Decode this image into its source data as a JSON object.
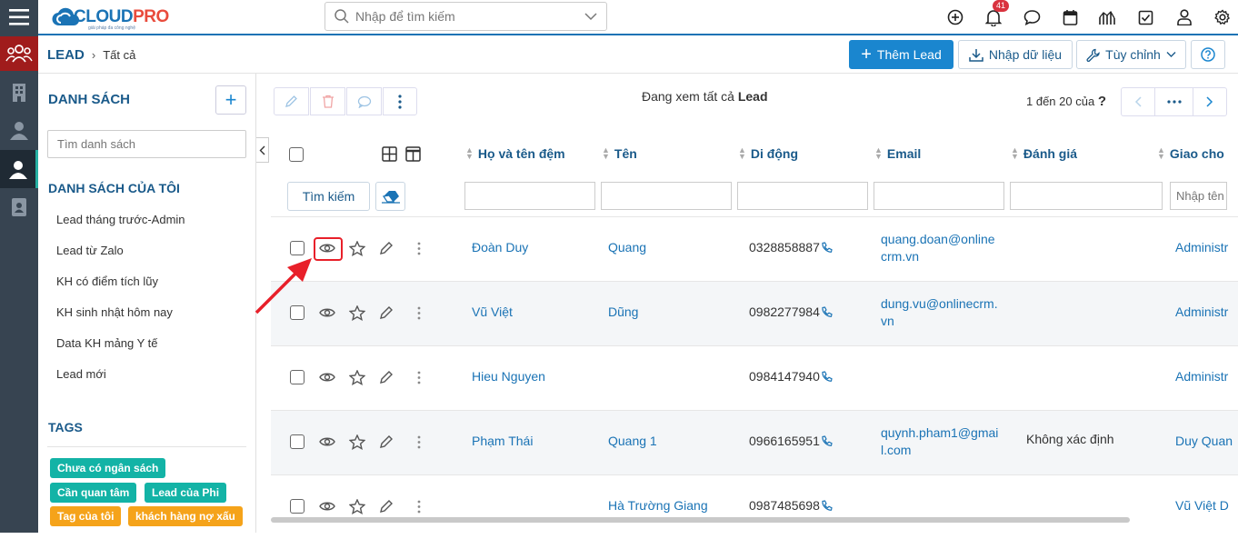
{
  "topbar": {
    "logo_text_a": "CLOUD",
    "logo_text_b": "PRO",
    "logo_sub": "giải pháp đa công nghệ",
    "search_placeholder": "Nhập để tìm kiếm",
    "notification_count": "41"
  },
  "breadcrumb": {
    "module": "LEAD",
    "separator": "›",
    "current": "Tất cả"
  },
  "actions": {
    "add_label": "Thêm Lead",
    "import_label": "Nhập dữ liệu",
    "customize_label": "Tùy chỉnh"
  },
  "sidebar": {
    "list_heading": "DANH SÁCH",
    "list_search_placeholder": "Tìm danh sách",
    "my_lists_heading": "DANH SÁCH CỦA TÔI",
    "my_lists": [
      "Lead tháng trước-Admin",
      "Lead từ Zalo",
      "KH có điểm tích lũy",
      "KH sinh nhật hôm nay",
      "Data KH mảng Y tế",
      "Lead mới"
    ],
    "tags_heading": "TAGS",
    "tags": [
      "Chưa có ngân sách",
      "Cần quan tâm",
      "Lead của Phi",
      "Tag của tôi",
      "khách hàng nợ xấu"
    ]
  },
  "list": {
    "viewing_prefix": "Đang xem tất cả",
    "viewing_module": "Lead",
    "pager_text": "1 đến 20 của",
    "pager_more": "?",
    "search_button": "Tìm kiếm",
    "columns": [
      "Họ và tên đệm",
      "Tên",
      "Di động",
      "Email",
      "Đánh giá",
      "Giao cho"
    ],
    "assign_filter_placeholder": "Nhập tên",
    "rows": [
      {
        "last": "Đoàn Duy",
        "first": "Quang",
        "mobile": "0328858887",
        "email1": "quang.doan@online",
        "email2": "crm.vn",
        "rating": "",
        "assigned": "Administr"
      },
      {
        "last": "Vũ Việt",
        "first": "Dũng",
        "mobile": "0982277984",
        "email1": "dung.vu@onlinecrm.",
        "email2": "vn",
        "rating": "",
        "assigned": "Administr"
      },
      {
        "last": "Hieu Nguyen",
        "first": "",
        "mobile": "0984147940",
        "email1": "",
        "email2": "",
        "rating": "",
        "assigned": "Administr"
      },
      {
        "last": "Phạm Thái",
        "first": "Quang 1",
        "mobile": "0966165951",
        "email1": "quynh.pham1@gmai",
        "email2": "l.com",
        "rating": "Không xác định",
        "assigned": "Duy Quan"
      },
      {
        "last": "",
        "first": "Hà Trường Giang",
        "mobile": "0987485698",
        "email1": "",
        "email2": "",
        "rating": "",
        "assigned": "Vũ Việt D"
      }
    ]
  },
  "colors": {
    "rail": "#374451",
    "primary": "#1a86cf",
    "link": "#1a73b5",
    "tag_teal": "#13b3a6",
    "tag_orange": "#f5a31a",
    "highlight_red": "#e8202a"
  }
}
